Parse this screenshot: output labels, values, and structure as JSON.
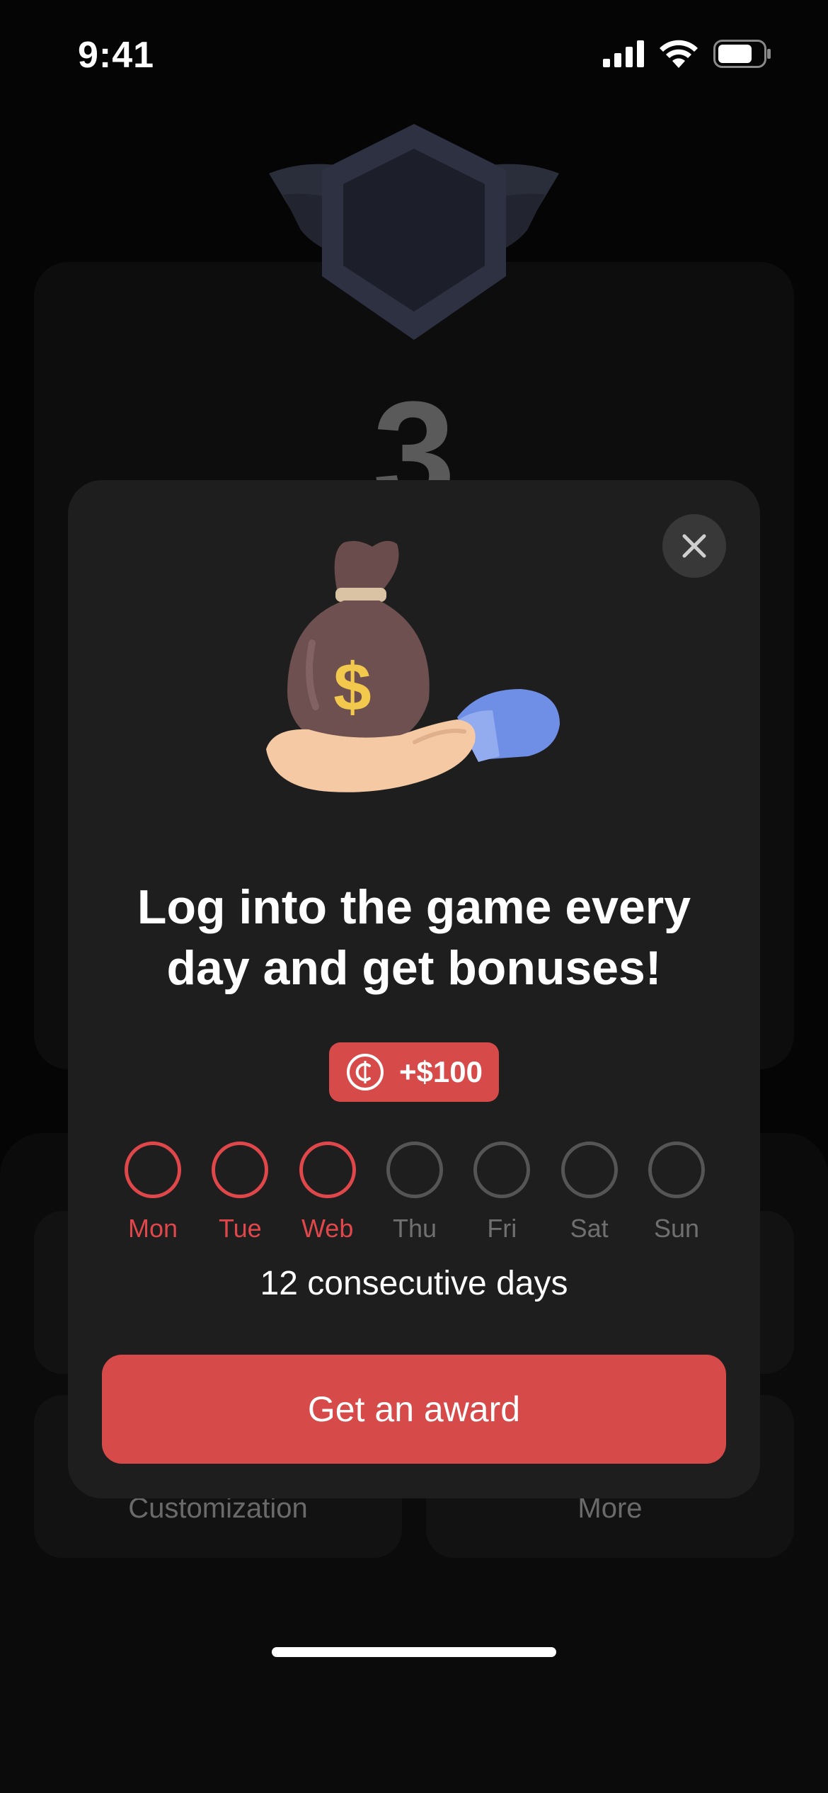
{
  "status_bar": {
    "time": "9:41"
  },
  "background": {
    "level_number": "3",
    "tiles": [
      {
        "label": "Customization"
      },
      {
        "label": "More"
      }
    ]
  },
  "modal": {
    "headline": "Log into the game every day and get bonuses!",
    "reward": {
      "amount": "+$100",
      "icon": "coin-icon"
    },
    "days": [
      {
        "label": "Mon",
        "done": true
      },
      {
        "label": "Tue",
        "done": true
      },
      {
        "label": "Web",
        "done": true
      },
      {
        "label": "Thu",
        "done": false
      },
      {
        "label": "Fri",
        "done": false
      },
      {
        "label": "Sat",
        "done": false
      },
      {
        "label": "Sun",
        "done": false
      }
    ],
    "streak_text": "12 consecutive days",
    "cta_label": "Get an award",
    "close_icon": "close-icon",
    "illustration": "money-bag-in-hand"
  },
  "colors": {
    "accent": "#d74a4a",
    "day_done": "#e0474b",
    "modal_bg": "#1e1e1e",
    "page_bg": "#050505"
  }
}
